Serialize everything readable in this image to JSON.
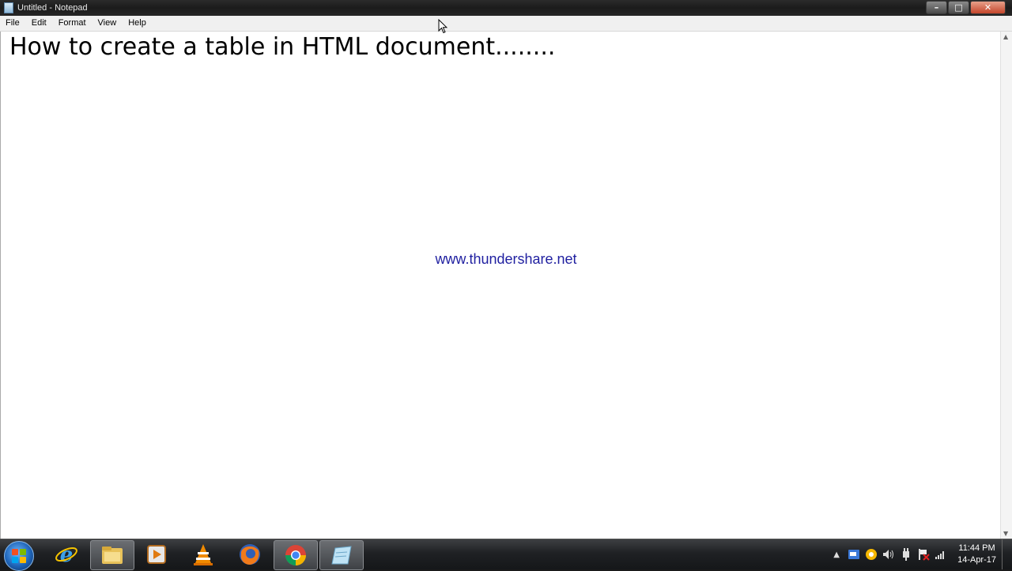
{
  "window": {
    "title": "Untitled - Notepad",
    "controls": {
      "minimize": "–",
      "maximize": "□",
      "close": "✕"
    }
  },
  "menu": {
    "items": [
      "File",
      "Edit",
      "Format",
      "View",
      "Help"
    ]
  },
  "editor": {
    "content": "How to create a table in HTML document........"
  },
  "watermark": "www.thundershare.net",
  "taskbar": {
    "pinned": [
      {
        "name": "internet-explorer-icon"
      },
      {
        "name": "file-explorer-icon"
      },
      {
        "name": "media-player-icon"
      },
      {
        "name": "vlc-icon"
      },
      {
        "name": "firefox-icon"
      },
      {
        "name": "chrome-icon"
      },
      {
        "name": "notepad-icon"
      }
    ],
    "tray": {
      "time": "11:44 PM",
      "date": "14-Apr-17"
    }
  },
  "colors": {
    "watermark": "#1f1fa0",
    "close_button": "#c4452a"
  }
}
